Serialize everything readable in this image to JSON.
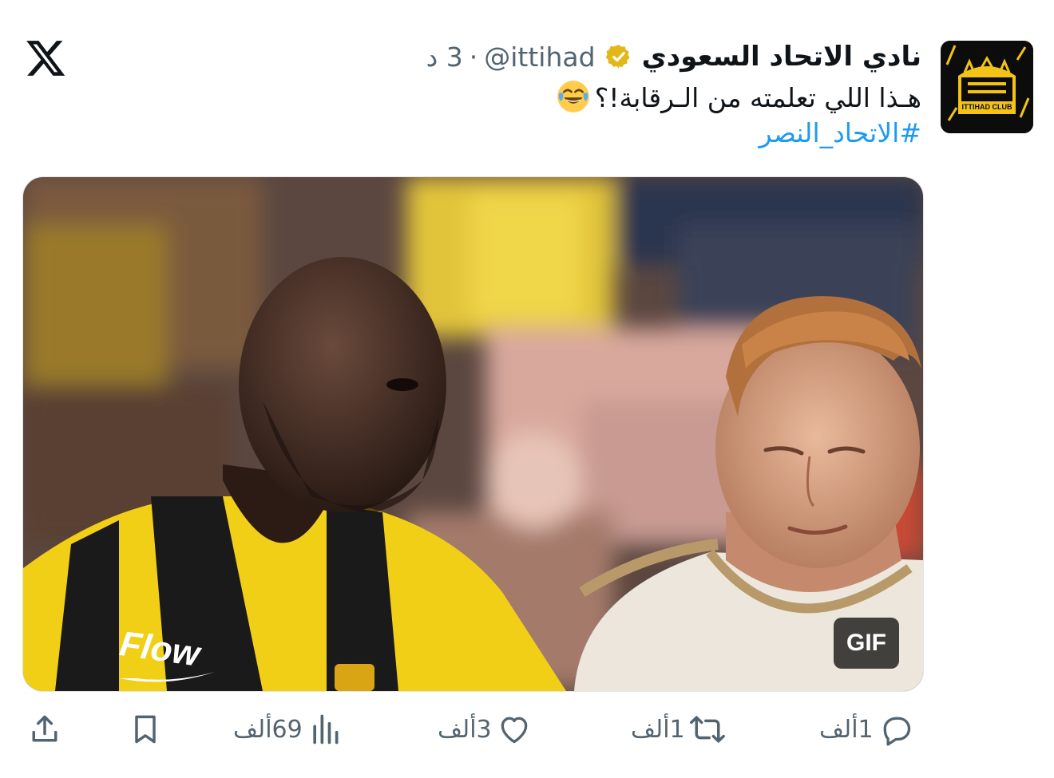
{
  "tweet": {
    "display_name": "نادي الاتحاد السعودي",
    "handle": "@ittihad",
    "separator": "·",
    "time": "3 د",
    "text": "هـذا اللي تعلمته من الـرقابة!؟",
    "hashtag": "#الاتحاد_النصر",
    "emoji": "face-with-tears-of-joy",
    "verified_badge_color": "#e2b719"
  },
  "avatar": {
    "brand_text": "ITTIHAD CLUB",
    "logo_color": "#f3c316"
  },
  "media": {
    "gif_label": "GIF",
    "jersey_text": "Flow"
  },
  "actions": {
    "reply_count": "1ألف",
    "retweet_count": "1ألف",
    "like_count": "3ألف",
    "views_count": "69ألف"
  },
  "colors": {
    "text": "#0f1419",
    "secondary": "#536471",
    "link": "#1d9bf0"
  }
}
